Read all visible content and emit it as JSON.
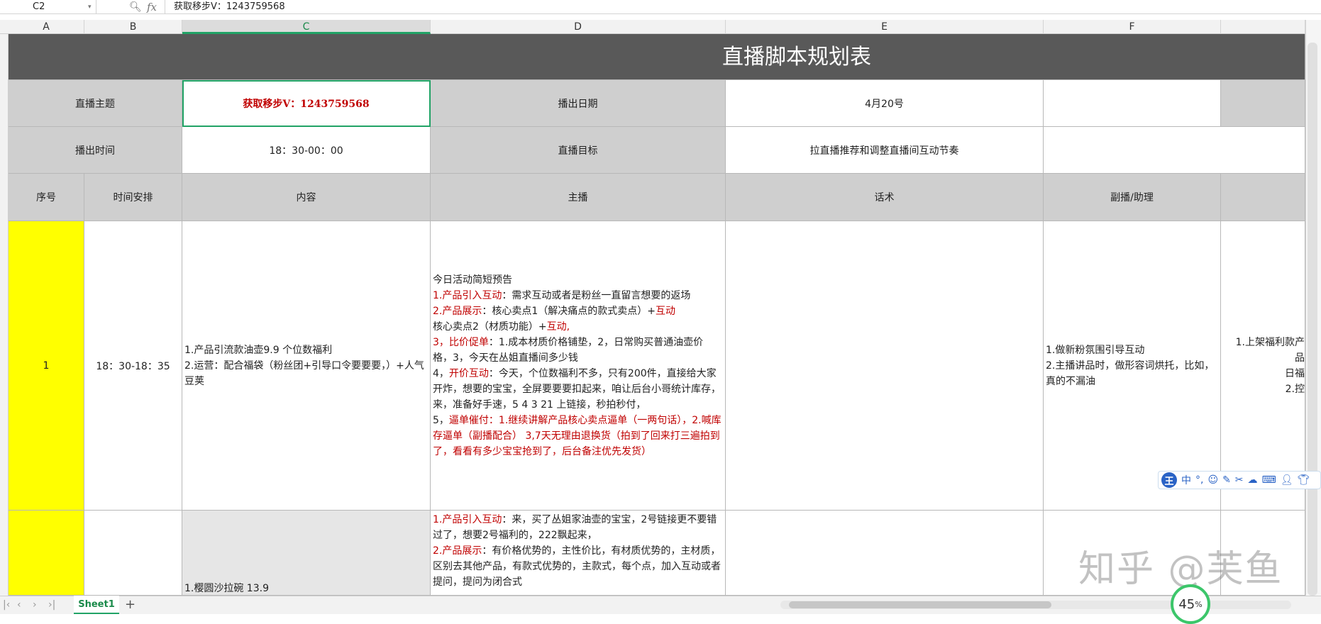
{
  "formula_bar": {
    "name_box": "C2",
    "formula": "获取移步V：1243759568"
  },
  "columns": [
    "A",
    "B",
    "C",
    "D",
    "E",
    "F"
  ],
  "sheet": {
    "title": "直播脚本规划表",
    "row_theme": {
      "label_theme": "直播主题",
      "theme_value": "获取移步V：1243759568",
      "label_date": "播出日期",
      "date_value": "4月20号"
    },
    "row_time": {
      "label_time": "播出时间",
      "time_value": "18：30-00：00",
      "label_goal": "直播目标",
      "goal_value": "拉直播推荐和调整直播间互动节奏"
    },
    "headers": [
      "序号",
      "时间安排",
      "内容",
      "主播",
      "话术",
      "副播/助理"
    ],
    "row1": {
      "index": "1",
      "time": "18：30-18：35",
      "content": "1.产品引流款油壶9.9 个位数福利\n2.运营：配合福袋（粉丝团+引导口令要要要，）+人气豆荚",
      "host": {
        "intro": "今日活动简短预告",
        "l1_red": "1.产品引入互动",
        "l1": "：需求互动或者是粉丝一直留言想要的返场",
        "l2_red": "2.产品展示",
        "l2": "：核心卖点1（解决痛点的款式卖点）+",
        "l2_red2": "互动",
        "l3": " 核心卖点2（材质功能）+",
        "l3_red": "互动,",
        "l4_red": "3，比价促单",
        "l4": "：1.成本材质价格铺垫，2，日常购买普通油壶价格，3，今天在丛姐直播间多少钱",
        "l5": "4，",
        "l5_red": "开价互动",
        "l5b": "：今天，个位数福利不多，只有200件，直接给大家开炸，想要的宝宝，全屏要要要扣起来，咱让后台小哥统计库存，来，准备好手速，5 4 3 21 上链接，秒拍秒付，",
        "l6": "5，",
        "l6_red": "逼单催付：1.继续讲解产品核心卖点逼单（一两句话），2.喊库存逼单（副播配合） 3,7天无理由退换货（拍到了回来打三遍拍到了，看看有多少宝宝抢到了，后台备注优先发货）"
      },
      "assistant": "1.做新粉氛围引导互动\n2.主播讲品时，做形容词烘托，比如，真的不漏油",
      "next_col": "1.上架福利款产品\n日福\n2.控"
    },
    "row2": {
      "content": "1.樱圆沙拉碗 13.9",
      "host": {
        "l1_red": "1.产品引入互动",
        "l1": "：来，买了丛姐家油壶的宝宝，2号链接更不要错过了，想要2号福利的，222飘起来，",
        "l2_red": "2.产品展示",
        "l2": "：有价格优势的，主性价比，有材质优势的，主材质，区别去其他产品，有款式优势的，主款式，每个点，加入互动或者提问，提问为闭合式"
      }
    }
  },
  "bottom": {
    "sheet_tab": "Sheet1",
    "add_sheet": "+"
  },
  "ime": {
    "logo": "王",
    "mode": "中"
  },
  "watermark": "知乎 @芙鱼",
  "progress": {
    "value": "45",
    "unit": "%"
  }
}
